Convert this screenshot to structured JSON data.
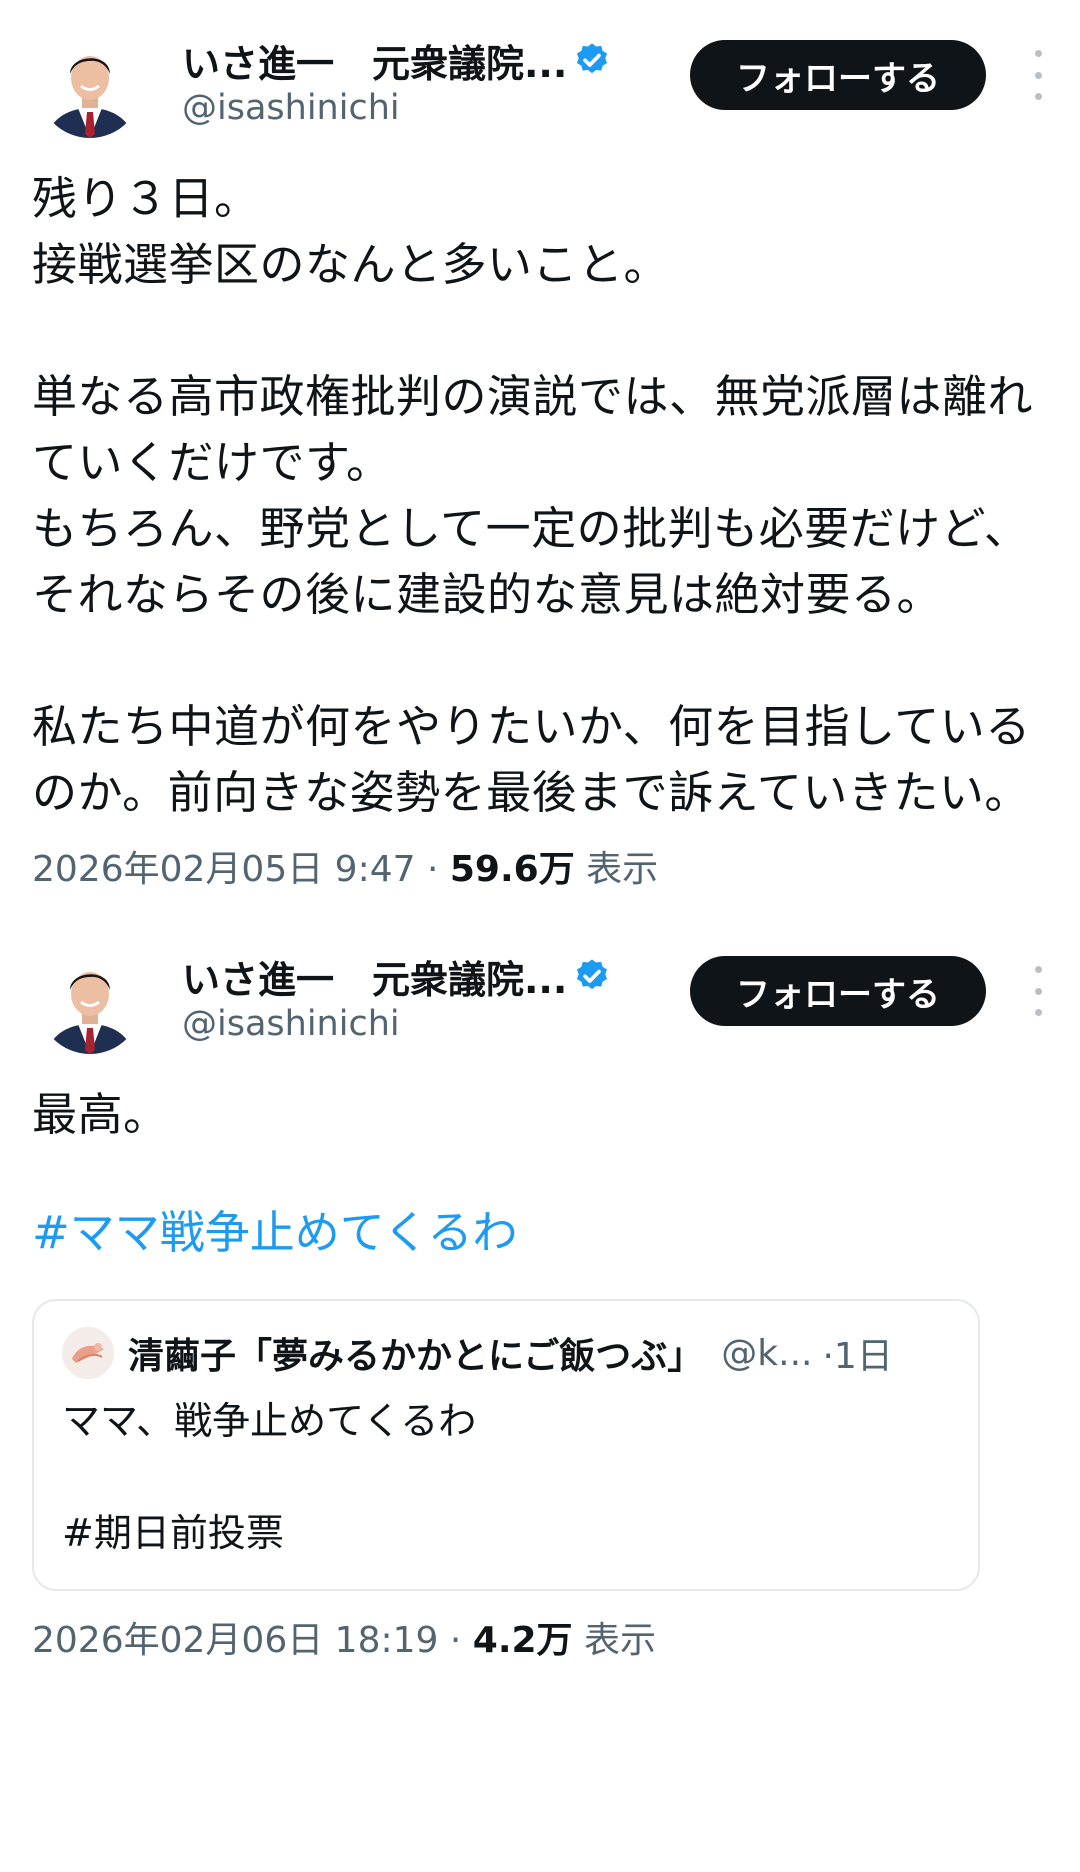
{
  "tweets": [
    {
      "author": {
        "name": "いさ進一　元衆議院...",
        "handle": "@isashinichi"
      },
      "follow_label": "フォローする",
      "text": "残り３日。\n接戦選挙区のなんと多いこと。\n\n単なる高市政権批判の演説では、無党派層は離れていくだけです。\nもちろん、野党として一定の批判も必要だけど、それならその後に建設的な意見は絶対要る。\n\n私たち中道が何をやりたいか、何を目指しているのか。前向きな姿勢を最後まで訴えていきたい。",
      "timestamp": "2026年02月05日 9:47",
      "separator": " · ",
      "views": "59.6万",
      "views_label": " 表示"
    },
    {
      "author": {
        "name": "いさ進一　元衆議院...",
        "handle": "@isashinichi"
      },
      "follow_label": "フォローする",
      "text": "最高。",
      "hashtag": "#ママ戦争止めてくるわ",
      "quote": {
        "name": "清繭子「夢みるかかとにご飯つぶ」",
        "handle": "@k...",
        "time": "·1日",
        "text": "ママ、戦争止めてくるわ\n\n#期日前投票"
      },
      "timestamp": "2026年02月06日 18:19",
      "separator": " · ",
      "views": "4.2万",
      "views_label": " 表示"
    }
  ],
  "colors": {
    "accent": "#1d9bf0",
    "text": "#0f1419",
    "muted": "#536471",
    "button": "#0f1419"
  },
  "icons": [
    "verified-badge-icon",
    "more-options-icon"
  ]
}
